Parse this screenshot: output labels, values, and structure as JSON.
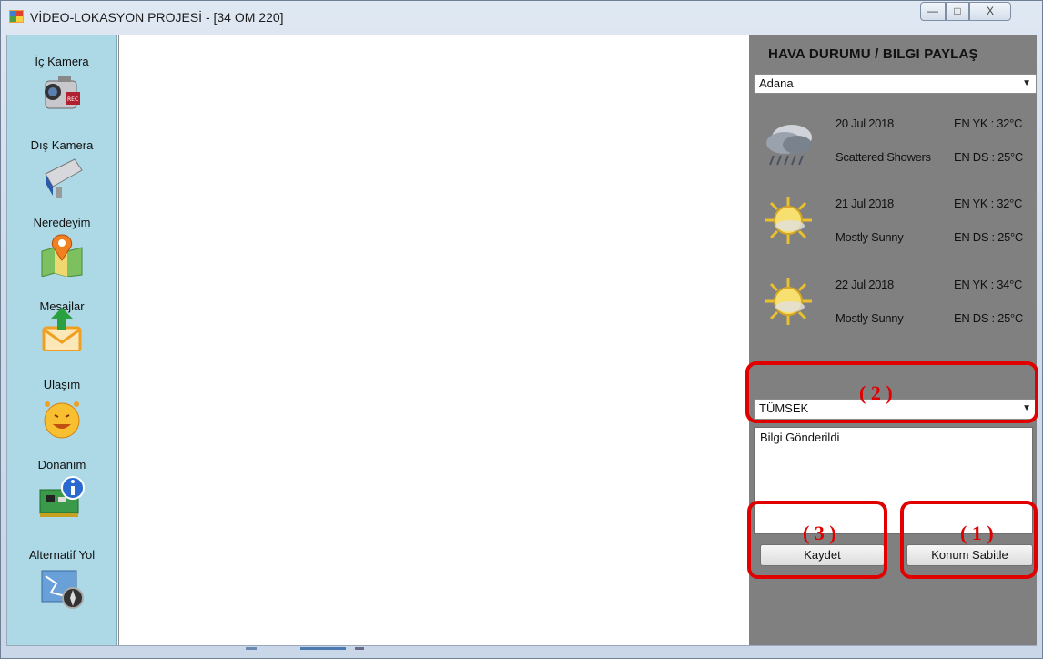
{
  "window": {
    "title": "VİDEO-LOKASYON PROJESİ - [34 OM 220]",
    "controls": {
      "minimize": "—",
      "maximize": "□",
      "close": "X"
    }
  },
  "sidebar": {
    "items": [
      {
        "label": "İç Kamera",
        "icon": "video-camera-icon"
      },
      {
        "label": "Dış Kamera",
        "icon": "security-camera-icon"
      },
      {
        "label": "Neredeyim",
        "icon": "map-pin-icon"
      },
      {
        "label": "Mesajlar",
        "icon": "mail-upload-icon"
      },
      {
        "label": "Ulaşım",
        "icon": "smiley-alarm-icon"
      },
      {
        "label": "Donanım",
        "icon": "hardware-info-icon"
      },
      {
        "label": "Alternatif Yol",
        "icon": "map-compass-icon"
      }
    ]
  },
  "weather": {
    "title": "HAVA DURUMU / BILGI PAYLAŞ",
    "city": "Adana",
    "days": [
      {
        "date": "20 Jul 2018",
        "condition": "Scattered Showers",
        "high": "EN YK : 32°C",
        "low": "EN DS : 25°C",
        "icon": "storm-cloud-icon"
      },
      {
        "date": "21 Jul 2018",
        "condition": "Mostly Sunny",
        "high": "EN YK : 32°C",
        "low": "EN DS : 25°C",
        "icon": "sun-icon"
      },
      {
        "date": "22 Jul 2018",
        "condition": "Mostly Sunny",
        "high": "EN YK : 34°C",
        "low": "EN DS : 25°C",
        "icon": "sun-icon"
      }
    ]
  },
  "share": {
    "category": "TÜMSEK",
    "message": "Bilgi Gönderildi",
    "save_label": "Kaydet",
    "fix_location_label": "Konum Sabitle"
  },
  "annotations": {
    "one": "( 1 )",
    "two": "( 2 )",
    "three": "( 3 )"
  },
  "colors": {
    "sidebar": "#add8e6",
    "panel": "#808080",
    "highlight": "#e00000"
  }
}
